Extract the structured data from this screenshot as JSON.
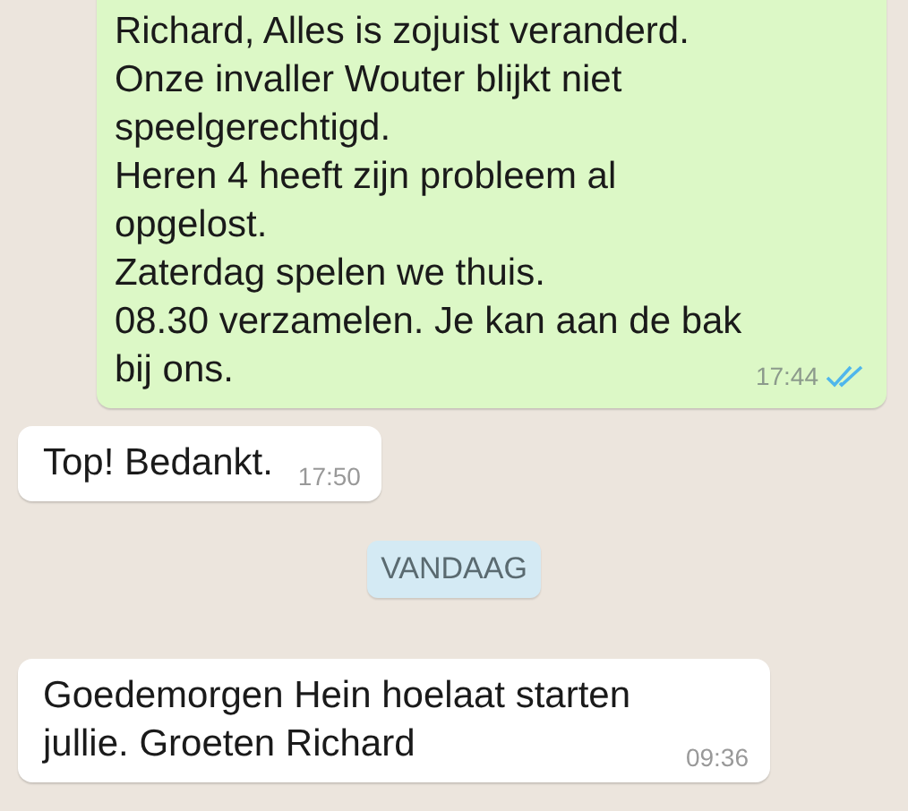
{
  "messages": [
    {
      "kind": "outgoing",
      "text": "Richard, Alles is zojuist veranderd.\nOnze invaller Wouter blijkt niet speelgerechtigd.\nHeren 4 heeft zijn probleem al opgelost.\nZaterdag spelen we thuis.\n08.30 verzamelen. Je kan aan de bak bij ons.",
      "time": "17:44",
      "read": true
    },
    {
      "kind": "incoming",
      "text": "Top! Bedankt.",
      "time": "17:50"
    },
    {
      "kind": "date",
      "text": "VANDAAG"
    },
    {
      "kind": "incoming",
      "text": "Goedemorgen Hein hoelaat starten jullie. Groeten Richard",
      "time": "09:36"
    }
  ]
}
